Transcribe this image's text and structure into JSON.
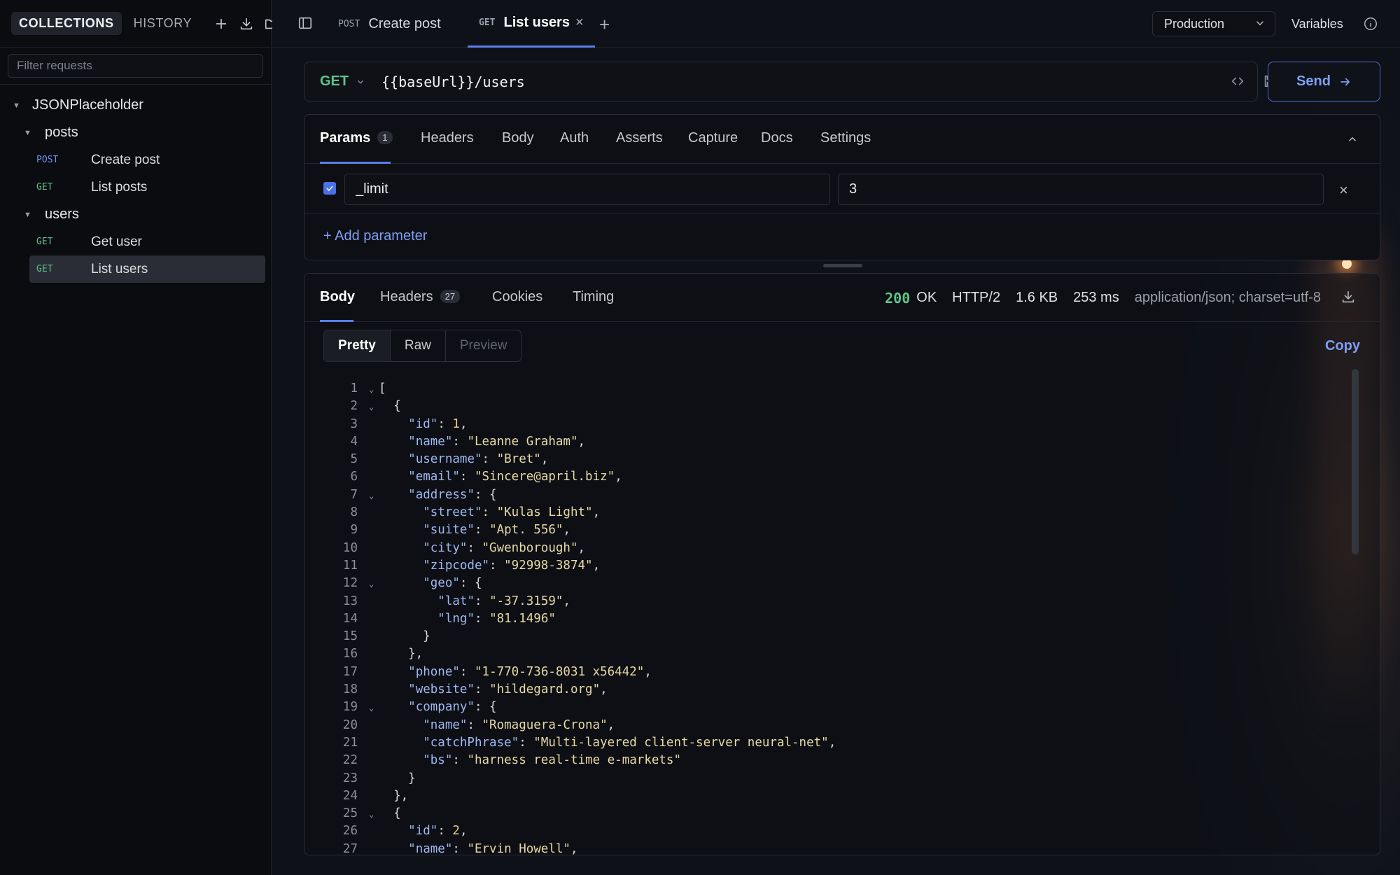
{
  "sidebar": {
    "tabs": [
      "COLLECTIONS",
      "HISTORY"
    ],
    "filter_placeholder": "Filter requests",
    "collection": "JSONPlaceholder",
    "folders": [
      {
        "name": "posts",
        "requests": [
          {
            "method": "POST",
            "name": "Create post"
          },
          {
            "method": "GET",
            "name": "List posts"
          }
        ]
      },
      {
        "name": "users",
        "requests": [
          {
            "method": "GET",
            "name": "Get user"
          },
          {
            "method": "GET",
            "name": "List users"
          }
        ]
      }
    ]
  },
  "tabs": [
    {
      "method": "POST",
      "label": "Create post"
    },
    {
      "method": "GET",
      "label": "List users"
    }
  ],
  "environment": "Production",
  "variables_label": "Variables",
  "request": {
    "method": "GET",
    "url": "{{baseUrl}}/users",
    "send_label": "Send"
  },
  "request_tabs": {
    "params": "Params",
    "params_count": "1",
    "headers": "Headers",
    "body": "Body",
    "auth": "Auth",
    "asserts": "Asserts",
    "capture": "Capture",
    "docs": "Docs",
    "settings": "Settings"
  },
  "params": [
    {
      "key": "_limit",
      "value": "3",
      "enabled": true
    }
  ],
  "add_param_label": "+ Add parameter",
  "response_tabs": {
    "body": "Body",
    "headers": "Headers",
    "headers_count": "27",
    "cookies": "Cookies",
    "timing": "Timing"
  },
  "response_status": {
    "code": "200",
    "text": "OK",
    "protocol": "HTTP/2",
    "size": "1.6 KB",
    "time": "253 ms",
    "content_type": "application/json; charset=utf-8"
  },
  "view_modes": [
    "Pretty",
    "Raw",
    "Preview"
  ],
  "copy_label": "Copy",
  "code_lines": [
    "[",
    "  {",
    "    \"id\": 1,",
    "    \"name\": \"Leanne Graham\",",
    "    \"username\": \"Bret\",",
    "    \"email\": \"Sincere@april.biz\",",
    "    \"address\": {",
    "      \"street\": \"Kulas Light\",",
    "      \"suite\": \"Apt. 556\",",
    "      \"city\": \"Gwenborough\",",
    "      \"zipcode\": \"92998-3874\",",
    "      \"geo\": {",
    "        \"lat\": \"-37.3159\",",
    "        \"lng\": \"81.1496\"",
    "      }",
    "    },",
    "    \"phone\": \"1-770-736-8031 x56442\",",
    "    \"website\": \"hildegard.org\",",
    "    \"company\": {",
    "      \"name\": \"Romaguera-Crona\",",
    "      \"catchPhrase\": \"Multi-layered client-server neural-net\",",
    "      \"bs\": \"harness real-time e-markets\"",
    "    }",
    "  },",
    "  {",
    "    \"id\": 2,",
    "    \"name\": \"Ervin Howell\","
  ],
  "fold_lines": [
    1,
    2,
    7,
    12,
    19,
    25
  ]
}
